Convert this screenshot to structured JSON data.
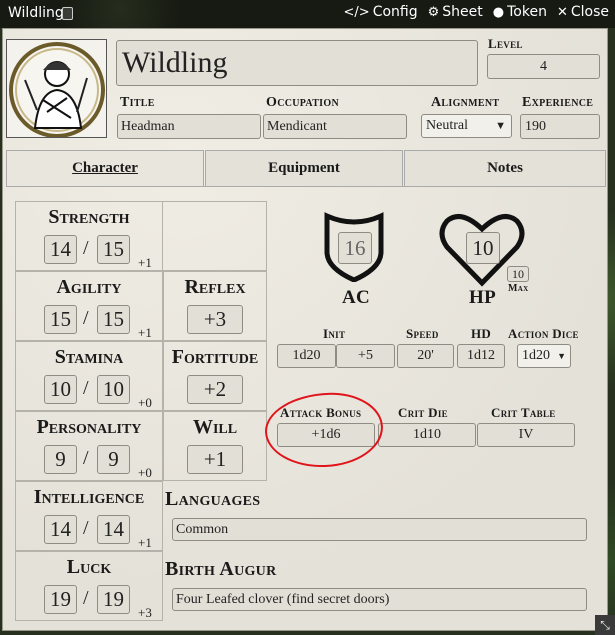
{
  "window": {
    "title": "Wildling",
    "controls": [
      {
        "icon": "code-icon",
        "glyph": "</>",
        "label": "Config"
      },
      {
        "icon": "gear-icon",
        "glyph": "⚙",
        "label": "Sheet"
      },
      {
        "icon": "user-circle-icon",
        "glyph": "●",
        "label": "Token"
      },
      {
        "icon": "close-icon",
        "glyph": "✕",
        "label": "Close"
      }
    ]
  },
  "character": {
    "name": "Wildling",
    "level_label": "Level",
    "level": "4",
    "title_label": "Title",
    "title": "Headman",
    "occupation_label": "Occupation",
    "occupation": "Mendicant",
    "alignment_label": "Alignment",
    "alignment": "Neutral",
    "experience_label": "Experience",
    "experience": "190"
  },
  "tabs": [
    {
      "label": "Character",
      "active": true
    },
    {
      "label": "Equipment",
      "active": false
    },
    {
      "label": "Notes",
      "active": false
    }
  ],
  "abilities": [
    {
      "name": "Strength",
      "current": "14",
      "max": "15",
      "mod": "+1"
    },
    {
      "name": "Agility",
      "current": "15",
      "max": "15",
      "mod": "+1"
    },
    {
      "name": "Stamina",
      "current": "10",
      "max": "10",
      "mod": "+0"
    },
    {
      "name": "Personality",
      "current": "9",
      "max": "9",
      "mod": "+0"
    },
    {
      "name": "Intelligence",
      "current": "14",
      "max": "14",
      "mod": "+1"
    },
    {
      "name": "Luck",
      "current": "19",
      "max": "19",
      "mod": "+3"
    }
  ],
  "saves": [
    {
      "name": "Reflex",
      "value": "+3"
    },
    {
      "name": "Fortitude",
      "value": "+2"
    },
    {
      "name": "Will",
      "value": "+1"
    }
  ],
  "ac": {
    "label": "AC",
    "value": "16"
  },
  "hp": {
    "label": "HP",
    "value": "10",
    "max": "10",
    "max_label": "Max"
  },
  "combat": {
    "init_label": "Init",
    "init_die": "1d20",
    "init_mod": "+5",
    "speed_label": "Speed",
    "speed": "20'",
    "hd_label": "HD",
    "hd": "1d12",
    "action_dice_label": "Action Dice",
    "action_dice": "1d20",
    "attack_bonus_label": "Attack Bonus",
    "attack_bonus": "+1d6",
    "crit_die_label": "Crit Die",
    "crit_die": "1d10",
    "crit_table_label": "Crit Table",
    "crit_table": "IV"
  },
  "languages_label": "Languages",
  "languages": "Common",
  "birth_augur_label": "Birth Augur",
  "birth_augur": "Four Leafed clover (find secret doors)",
  "annotation_color": "#e0141a"
}
